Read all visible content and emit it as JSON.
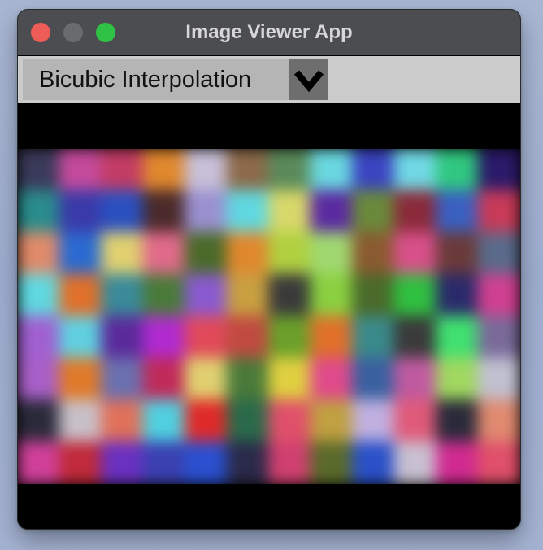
{
  "window": {
    "title": "Image Viewer App"
  },
  "toolbar": {
    "interpolation_select": {
      "selected": "Bicubic Interpolation"
    }
  },
  "image": {
    "palette": [
      [
        "#3a3a5a",
        "#c44a9c",
        "#c23c64",
        "#e0882e",
        "#c8c0d8",
        "#8c6a4a",
        "#5a8a5a",
        "#6ad8e0",
        "#3a44c0",
        "#70d8e4",
        "#30c880",
        "#2a1a6a"
      ],
      [
        "#2a8c8c",
        "#3a3aa8",
        "#2a50c0",
        "#4a2a2a",
        "#9a90d0",
        "#60d8e0",
        "#d8d86a",
        "#5a2aa0",
        "#6a8a3a",
        "#8a2a3a",
        "#3a60c0",
        "#c83a58"
      ],
      [
        "#e08a6a",
        "#2a6ad0",
        "#e0d070",
        "#e06a8a",
        "#4a6a2a",
        "#e0882e",
        "#b0d040",
        "#a0d870",
        "#8a5a30",
        "#d8508a",
        "#6a3a3a",
        "#5a6a8a"
      ],
      [
        "#60d8e0",
        "#e0702a",
        "#3a8a9a",
        "#4a7a3a",
        "#8a5ad0",
        "#c8a040",
        "#3a3a3a",
        "#8ad040",
        "#4a6a2a",
        "#30c040",
        "#2a2a6a",
        "#d04090"
      ],
      [
        "#a060d0",
        "#60d0e0",
        "#5a2a9a",
        "#b02ad0",
        "#e04a5a",
        "#c04a40",
        "#6aa02a",
        "#e0702a",
        "#3a8a8a",
        "#3a3a3a",
        "#40e070",
        "#7a6a9a"
      ],
      [
        "#a860c8",
        "#e07a2a",
        "#6a70b0",
        "#c02a5a",
        "#e0d070",
        "#4a7a3a",
        "#e0d040",
        "#e04a8a",
        "#3a60a0",
        "#c05aa0",
        "#a0d860",
        "#c0c0d0"
      ],
      [
        "#2a2a3a",
        "#c8c0c8",
        "#e0705a",
        "#50d0e0",
        "#e02a2a",
        "#2a6a4a",
        "#e0506a",
        "#c0a040",
        "#c0b0e0",
        "#e05a7a",
        "#2a2a3a",
        "#e08a70"
      ],
      [
        "#d0409a",
        "#c02a3a",
        "#6a30c0",
        "#3a40b0",
        "#2a50d0",
        "#2a2a4a",
        "#d04070",
        "#5a6a2a",
        "#2a50c8",
        "#c8c0d0",
        "#d02a90",
        "#e0506a"
      ]
    ]
  }
}
